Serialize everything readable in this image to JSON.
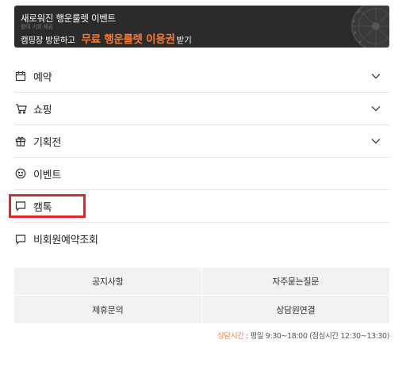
{
  "banner": {
    "title": "새로워진 행운룰렛 이벤트",
    "ghost_text": "참여 기회 제공",
    "prefix": "캠핑장 방문하고",
    "highlight": "무료 행운룰렛 이용권",
    "suffix": "받기",
    "accent_color": "#ff7a2e"
  },
  "menu": {
    "items": [
      {
        "label": "예약",
        "icon": "calendar-icon",
        "has_chevron": true
      },
      {
        "label": "쇼핑",
        "icon": "cart-icon",
        "has_chevron": true
      },
      {
        "label": "기획전",
        "icon": "gift-icon",
        "has_chevron": true
      },
      {
        "label": "이벤트",
        "icon": "smile-icon",
        "has_chevron": false
      },
      {
        "label": "캠톡",
        "icon": "chat-icon",
        "has_chevron": false,
        "highlighted": true
      },
      {
        "label": "비회원예약조회",
        "icon": "chat-icon",
        "has_chevron": false
      }
    ],
    "highlight_color": "#e0262b"
  },
  "links": {
    "notice": "공지사항",
    "faq": "자주묻는질문",
    "partnership": "제휴문의",
    "counsel": "상담원연결"
  },
  "hours": {
    "label": "상담시간",
    "text": "평일 9:30~18:00 (점심시간 12:30~13:30)"
  }
}
